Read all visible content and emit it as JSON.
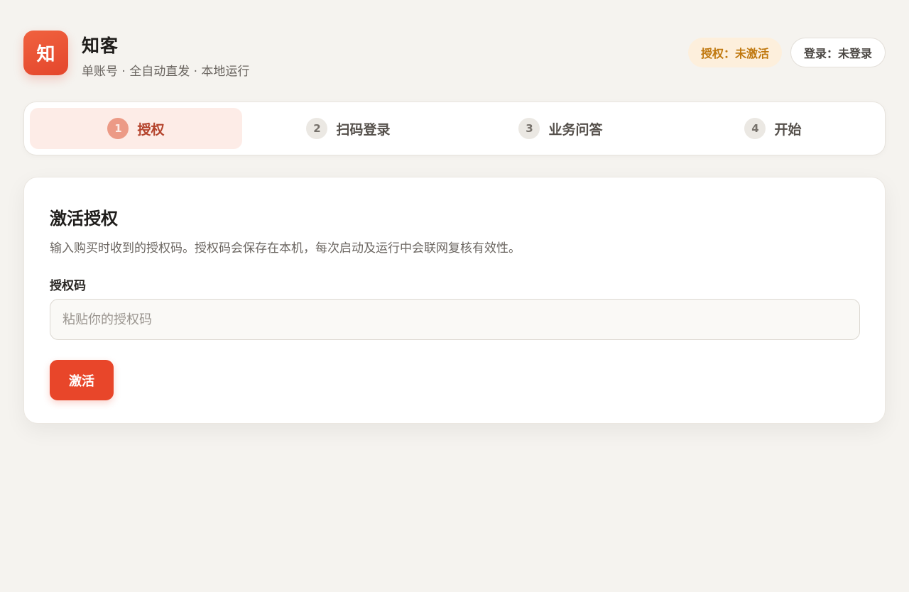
{
  "header": {
    "logo_text": "知",
    "title": "知客",
    "subtitle": "单账号 · 全自动直发 · 本地运行",
    "auth_badge": "授权：未激活",
    "login_badge": "登录：未登录"
  },
  "steps": [
    {
      "num": "1",
      "label": "授权",
      "active": true
    },
    {
      "num": "2",
      "label": "扫码登录",
      "active": false
    },
    {
      "num": "3",
      "label": "业务问答",
      "active": false
    },
    {
      "num": "4",
      "label": "开始",
      "active": false
    }
  ],
  "card": {
    "title": "激活授权",
    "description": "输入购买时收到的授权码。授权码会保存在本机，每次启动及运行中会联网复核有效性。",
    "field_label": "授权码",
    "input_value": "",
    "input_placeholder": "粘贴你的授权码",
    "button_label": "激活"
  },
  "colors": {
    "accent": "#e8462a",
    "background": "#f5f3ef",
    "auth_badge_text": "#c0780e",
    "auth_badge_bg": "#fdefdc"
  }
}
